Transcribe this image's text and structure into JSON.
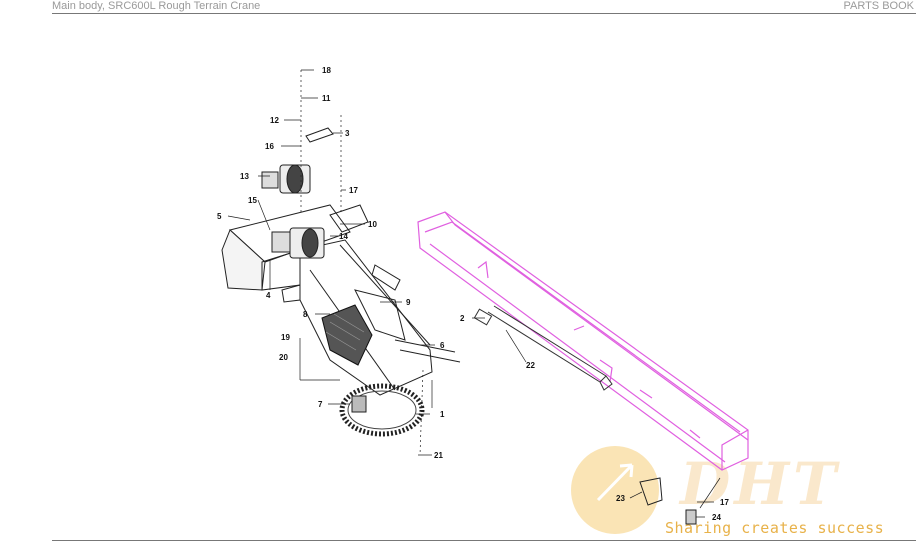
{
  "header": {
    "title": "Main body, SRC600L Rough Terrain Crane",
    "section": "PARTS BOOK"
  },
  "callouts": [
    {
      "id": "c18",
      "label": "18"
    },
    {
      "id": "c11",
      "label": "11"
    },
    {
      "id": "c12",
      "label": "12"
    },
    {
      "id": "c3",
      "label": "3"
    },
    {
      "id": "c16",
      "label": "16"
    },
    {
      "id": "c13",
      "label": "13"
    },
    {
      "id": "c17a",
      "label": "17"
    },
    {
      "id": "c15",
      "label": "15"
    },
    {
      "id": "c5",
      "label": "5"
    },
    {
      "id": "c10",
      "label": "10"
    },
    {
      "id": "c14",
      "label": "14"
    },
    {
      "id": "c4",
      "label": "4"
    },
    {
      "id": "c9",
      "label": "9"
    },
    {
      "id": "c8",
      "label": "8"
    },
    {
      "id": "c2",
      "label": "2"
    },
    {
      "id": "c19",
      "label": "19"
    },
    {
      "id": "c6",
      "label": "6"
    },
    {
      "id": "c20",
      "label": "20"
    },
    {
      "id": "c22",
      "label": "22"
    },
    {
      "id": "c7",
      "label": "7"
    },
    {
      "id": "c1",
      "label": "1"
    },
    {
      "id": "c21",
      "label": "21"
    },
    {
      "id": "c23",
      "label": "23"
    },
    {
      "id": "c17b",
      "label": "17"
    },
    {
      "id": "c24",
      "label": "24"
    }
  ],
  "watermark": {
    "logo": "DHT",
    "tagline": "Sharing creates success"
  },
  "colors": {
    "boom": "#e060e0",
    "lines": "#222222",
    "watermark": "#f0b040"
  }
}
